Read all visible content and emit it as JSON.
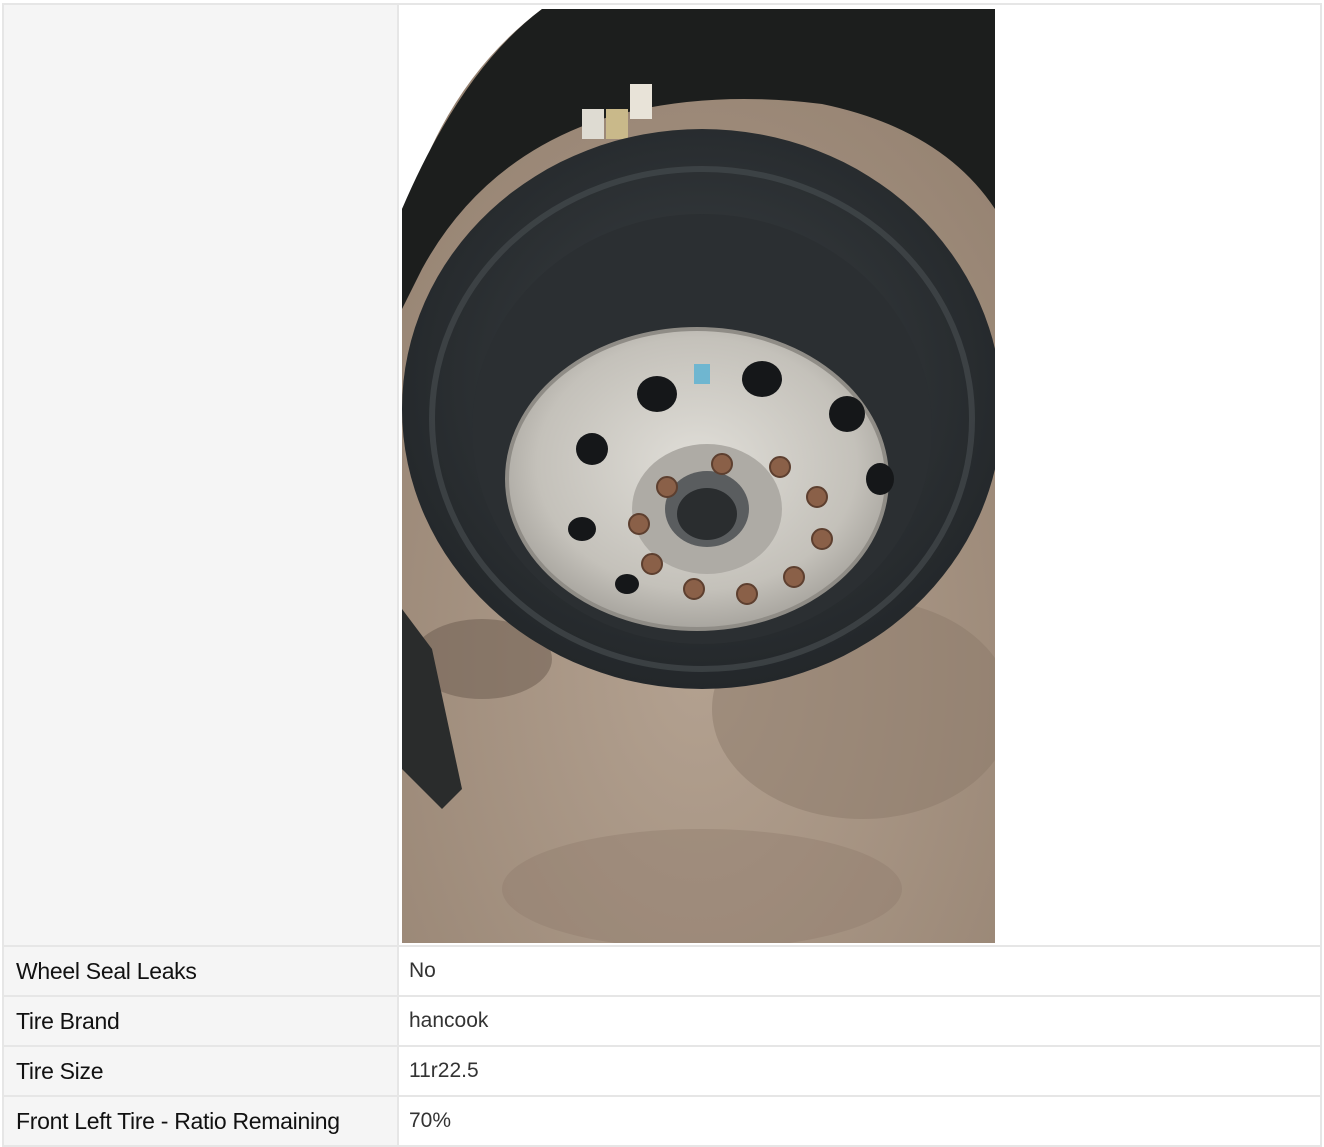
{
  "inspection": {
    "photo": {
      "icon": "tire-photo",
      "colors": {
        "ground": "#a89584",
        "tire": "#2f3336",
        "rim": "#c9c7c2",
        "lug": "#8a6048",
        "body": "#1c1e1d"
      }
    },
    "rows": [
      {
        "label": "Wheel Seal Leaks",
        "value": "No"
      },
      {
        "label": "Tire Brand",
        "value": "hancook"
      },
      {
        "label": "Tire Size",
        "value": "11r22.5"
      },
      {
        "label": "Front Left Tire - Ratio Remaining",
        "value": "70%"
      }
    ]
  }
}
